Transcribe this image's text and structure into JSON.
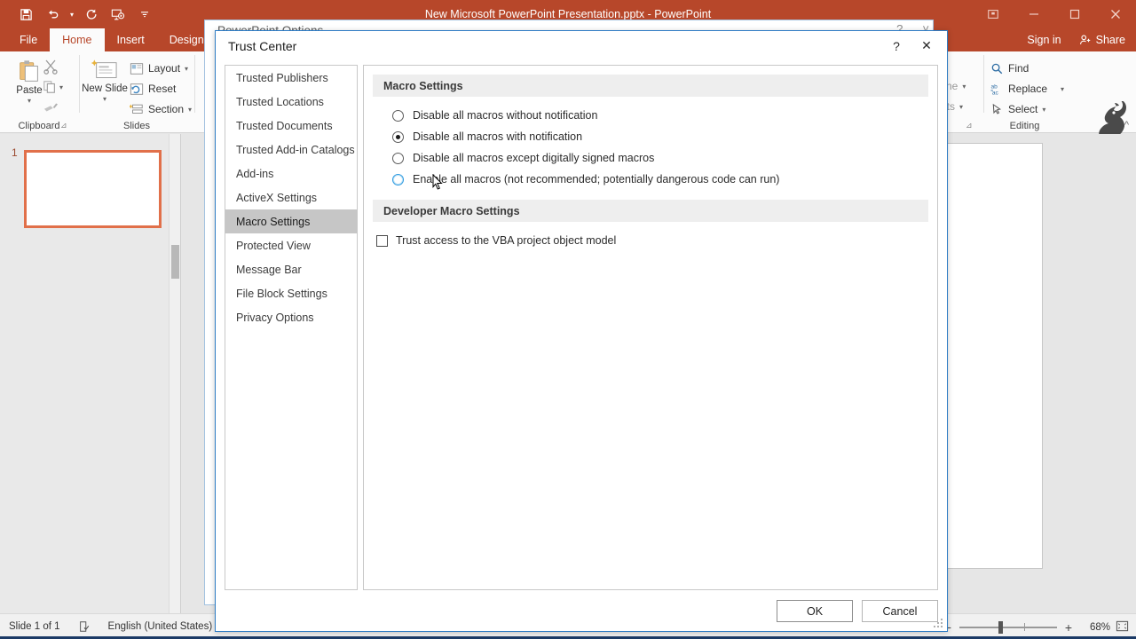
{
  "window": {
    "title": "New Microsoft PowerPoint Presentation.pptx - PowerPoint",
    "quick_access": [
      {
        "name": "save-icon",
        "tooltip": "Save"
      },
      {
        "name": "undo-icon",
        "tooltip": "Undo"
      },
      {
        "name": "redo-icon",
        "tooltip": "Redo"
      },
      {
        "name": "start-slideshow-icon",
        "tooltip": "Start From Beginning"
      },
      {
        "name": "customize-qat-icon",
        "tooltip": "Customize Quick Access Toolbar"
      }
    ],
    "controls": {
      "ribbon_display": "ribbon-display-options-icon",
      "minimize": "minimize-icon",
      "restore": "restore-icon",
      "close": "close-icon"
    },
    "sign_in": "Sign in",
    "share": "Share",
    "accent": "#b7472a"
  },
  "ribbon": {
    "tabs": [
      {
        "label": "File",
        "active": false
      },
      {
        "label": "Home",
        "active": true
      },
      {
        "label": "Insert",
        "active": false
      },
      {
        "label": "Design",
        "active": false
      }
    ],
    "groups": [
      {
        "name": "clipboard",
        "label": "Clipboard",
        "items": [
          {
            "label": "Paste",
            "icon": "paste-icon"
          },
          {
            "label": "Cut",
            "icon": "cut-icon"
          },
          {
            "label": "Copy",
            "icon": "copy-icon"
          },
          {
            "label": "Format Painter",
            "icon": "format-painter-icon"
          }
        ]
      },
      {
        "name": "slides",
        "label": "Slides",
        "items": [
          {
            "label": "New Slide",
            "icon": "new-slide-icon"
          },
          {
            "label": "Layout",
            "icon": "layout-icon"
          },
          {
            "label": "Reset",
            "icon": "reset-icon"
          },
          {
            "label": "Section",
            "icon": "section-icon"
          }
        ]
      },
      {
        "name": "editing",
        "label": "Editing",
        "items": [
          {
            "label": "Find",
            "icon": "search-icon"
          },
          {
            "label": "Replace",
            "icon": "replace-icon"
          },
          {
            "label": "Select",
            "icon": "select-icon"
          }
        ]
      }
    ],
    "partial_labels": [
      "dline",
      "ects"
    ],
    "collapse_icon": "chevron-up-icon"
  },
  "slide_pane": {
    "slide_number": "1"
  },
  "status_bar": {
    "slide_status": "Slide 1 of 1",
    "spellcheck_icon": "spellcheck-icon",
    "language": "English (United States)",
    "zoom_out": "−",
    "zoom_in": "+",
    "zoom_level": "68%",
    "fit_icon": "fit-to-window-icon"
  },
  "options_dialog": {
    "title": "PowerPoint Options",
    "help": "?",
    "close": "˅"
  },
  "trust_center": {
    "title": "Trust Center",
    "help_label": "?",
    "close_label": "✕",
    "nav": [
      {
        "label": "Trusted Publishers",
        "selected": false
      },
      {
        "label": "Trusted Locations",
        "selected": false
      },
      {
        "label": "Trusted Documents",
        "selected": false
      },
      {
        "label": "Trusted Add-in Catalogs",
        "selected": false
      },
      {
        "label": "Add-ins",
        "selected": false
      },
      {
        "label": "ActiveX Settings",
        "selected": false
      },
      {
        "label": "Macro Settings",
        "selected": true
      },
      {
        "label": "Protected View",
        "selected": false
      },
      {
        "label": "Message Bar",
        "selected": false
      },
      {
        "label": "File Block Settings",
        "selected": false
      },
      {
        "label": "Privacy Options",
        "selected": false
      }
    ],
    "macro_settings": {
      "heading": "Macro Settings",
      "options": [
        {
          "label": "Disable all macros without notification",
          "checked": false,
          "hover": false
        },
        {
          "label": "Disable all macros with notification",
          "checked": true,
          "hover": false
        },
        {
          "label": "Disable all macros except digitally signed macros",
          "checked": false,
          "hover": false
        },
        {
          "label": "Enable all macros (not recommended; potentially dangerous code can run)",
          "checked": false,
          "hover": true
        }
      ]
    },
    "developer_macro_settings": {
      "heading": "Developer Macro Settings",
      "checkbox_label": "Trust access to the VBA project object model",
      "checked": false
    },
    "buttons": {
      "ok": "OK",
      "cancel": "Cancel"
    },
    "border_color": "#2e7cc4"
  }
}
